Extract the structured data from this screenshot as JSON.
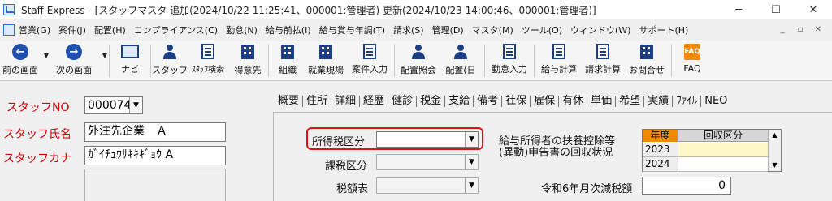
{
  "window": {
    "title": "Staff Express - [スタッフマスタ 追加(2024/10/22 11:25:41、000001:管理者) 更新(2024/10/23 14:00:46、000001:管理者)]",
    "minimize": "─",
    "maximize": "☐",
    "close": "✕"
  },
  "menu": {
    "items": [
      "営業(G)",
      "案件(J)",
      "配置(H)",
      "コンプライアンス(C)",
      "勤怠(N)",
      "給与前払(I)",
      "給与賞与年調(T)",
      "請求(S)",
      "管理(D)",
      "マスタ(M)",
      "ツール(O)",
      "ウィンドウ(W)",
      "サポート(H)"
    ],
    "mdi_min": "_",
    "mdi_restore": "▫",
    "mdi_close": "✕"
  },
  "toolbar": {
    "prev": "前の画面",
    "next": "次の画面",
    "nav": "ナビ",
    "staff": "スタッフ",
    "staff_search": "ｽﾀｯﾌ検索",
    "customer": "得意先",
    "organization": "組織",
    "site": "就業現場",
    "job_entry": "案件入力",
    "assign_inquiry": "配置照会",
    "assign_day": "配置(日",
    "attendance_entry": "勤怠入力",
    "payroll_calc": "給与計算",
    "billing_calc": "請求計算",
    "contact": "お問合せ",
    "faq": "FAQ",
    "faq_icon_text": "FAQ"
  },
  "staff": {
    "no_label": "スタッフNO",
    "no_value": "000074",
    "name_label": "スタッフ氏名",
    "name_value": "外注先企業　Ａ",
    "kana_label": "スタッフカナ",
    "kana_value": "ｶﾞｲﾁｭｳｻｷｷｷﾞｮｳ A"
  },
  "tabs": [
    "概要",
    "住所",
    "詳細",
    "経歴",
    "健診",
    "税金",
    "支給",
    "備考",
    "社保",
    "雇保",
    "有休",
    "単価",
    "希望",
    "実績",
    "ﾌｧｲﾙ",
    "NEO"
  ],
  "tax": {
    "income_tax_category_label": "所得税区分",
    "income_tax_category_value": "",
    "taxation_category_label": "課税区分",
    "taxation_category_value": "",
    "tax_table_label": "税額表",
    "tax_table_value": "",
    "dependent_report_label_line1": "給与所得者の扶養控除等",
    "dependent_report_label_line2": "(異動)申告書の回収状況",
    "grid_col_year": "年度",
    "grid_col_status": "回収区分",
    "grid_rows": [
      {
        "year": "2023",
        "status": ""
      },
      {
        "year": "2024",
        "status": ""
      }
    ],
    "reduction_label": "令和6年月次減税額",
    "reduction_value": "0"
  }
}
